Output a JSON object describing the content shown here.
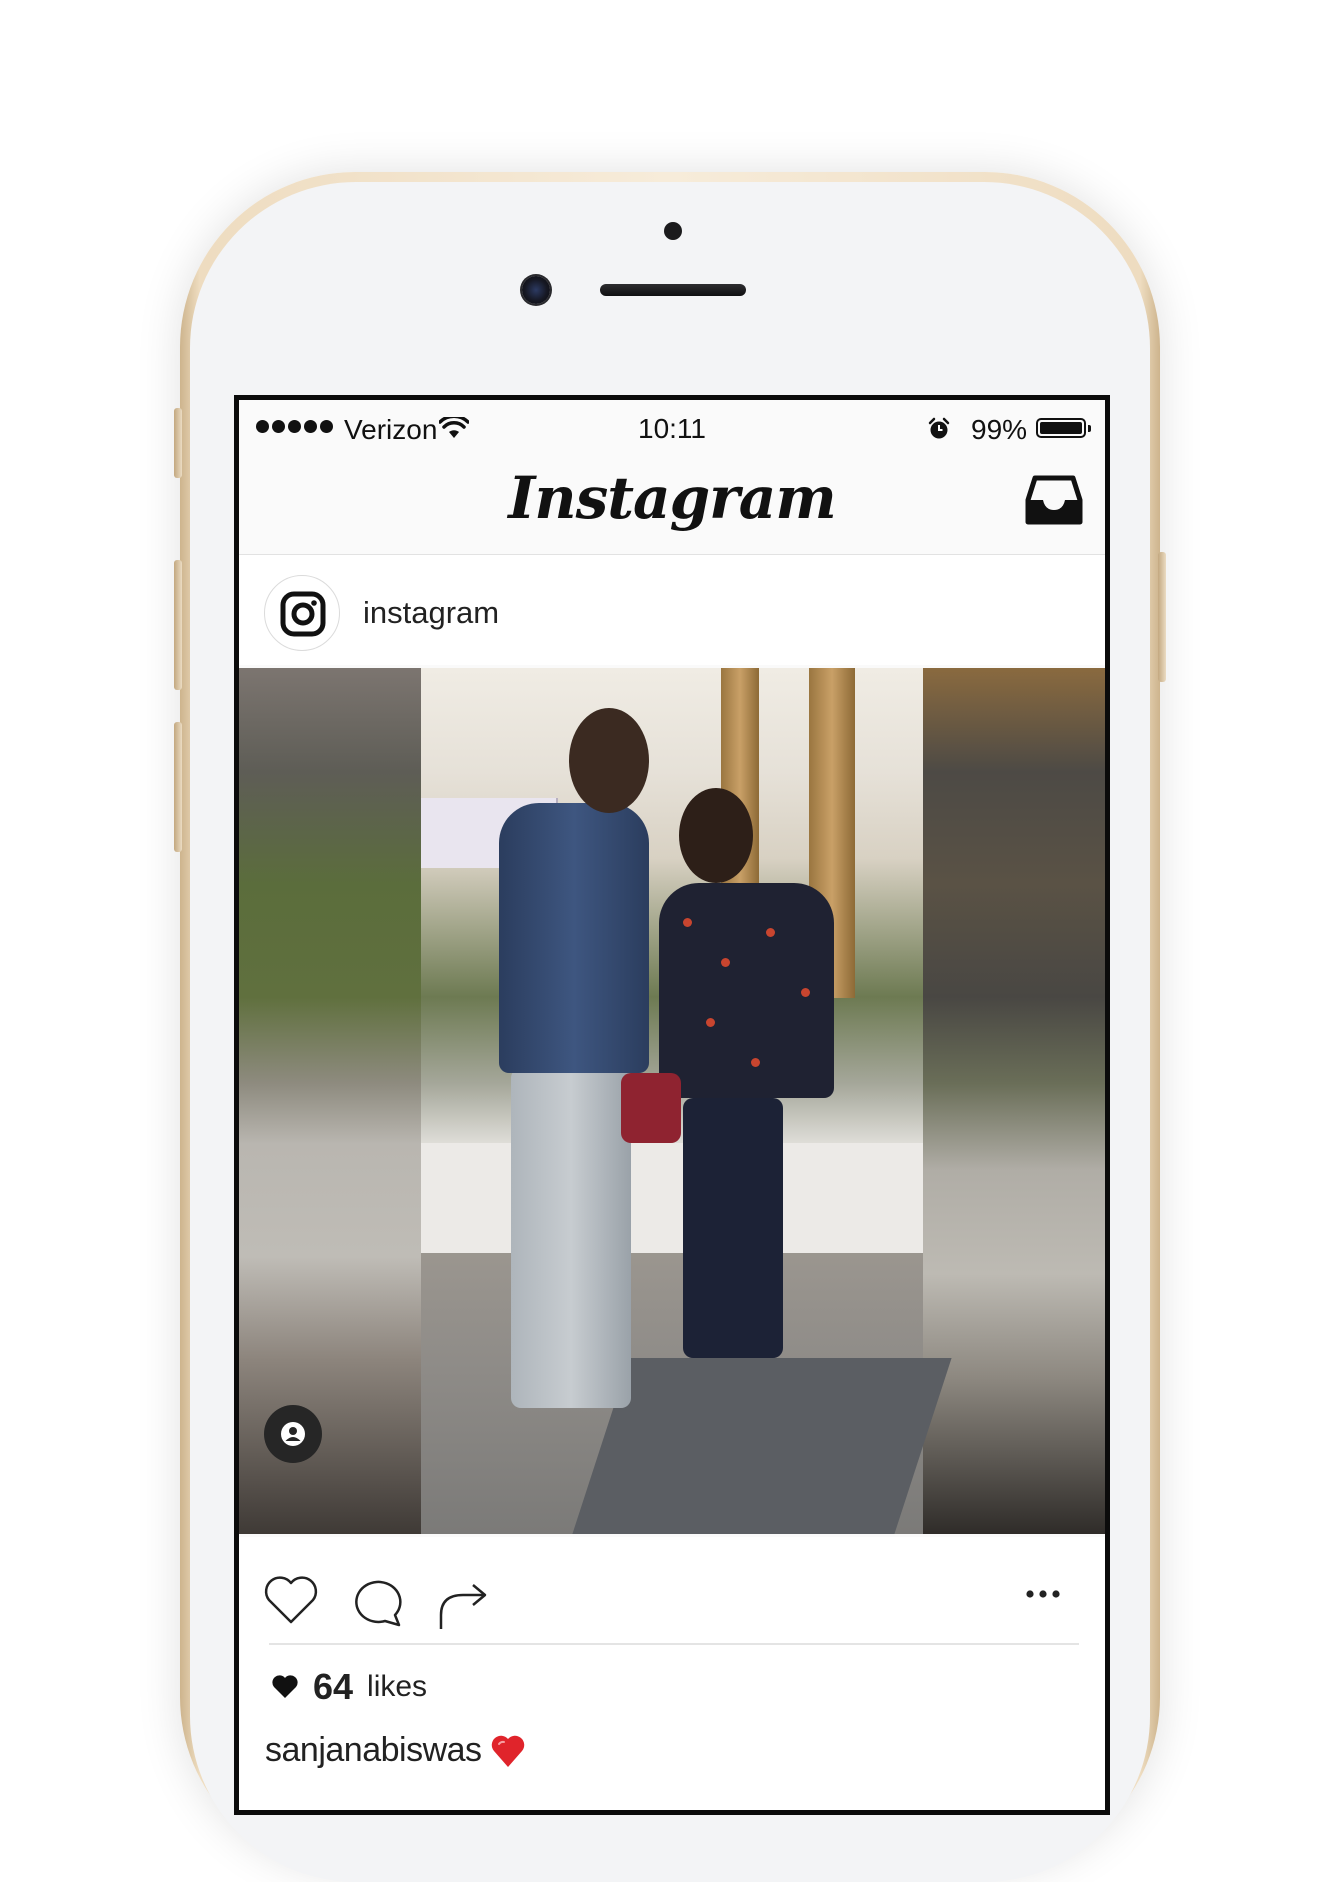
{
  "status_bar": {
    "carrier": "Verizon",
    "time": "10:11",
    "battery_percent": "99%",
    "battery_level": 0.99,
    "icons": [
      "signal-dots-icon",
      "wifi-icon",
      "alarm-icon",
      "battery-icon"
    ]
  },
  "navbar": {
    "logo_text": "Instagram",
    "inbox_icon": "inbox-tray-icon"
  },
  "post": {
    "username": "instagram",
    "avatar_icon": "instagram-logo-icon",
    "tag_icon": "user-tag-icon",
    "actions": [
      "heart-outline-icon",
      "comment-bubble-icon",
      "share-arrow-icon",
      "more-dots-icon"
    ],
    "likes_count": "64",
    "likes_label": "likes",
    "caption_user": "sanjanabiswas"
  }
}
